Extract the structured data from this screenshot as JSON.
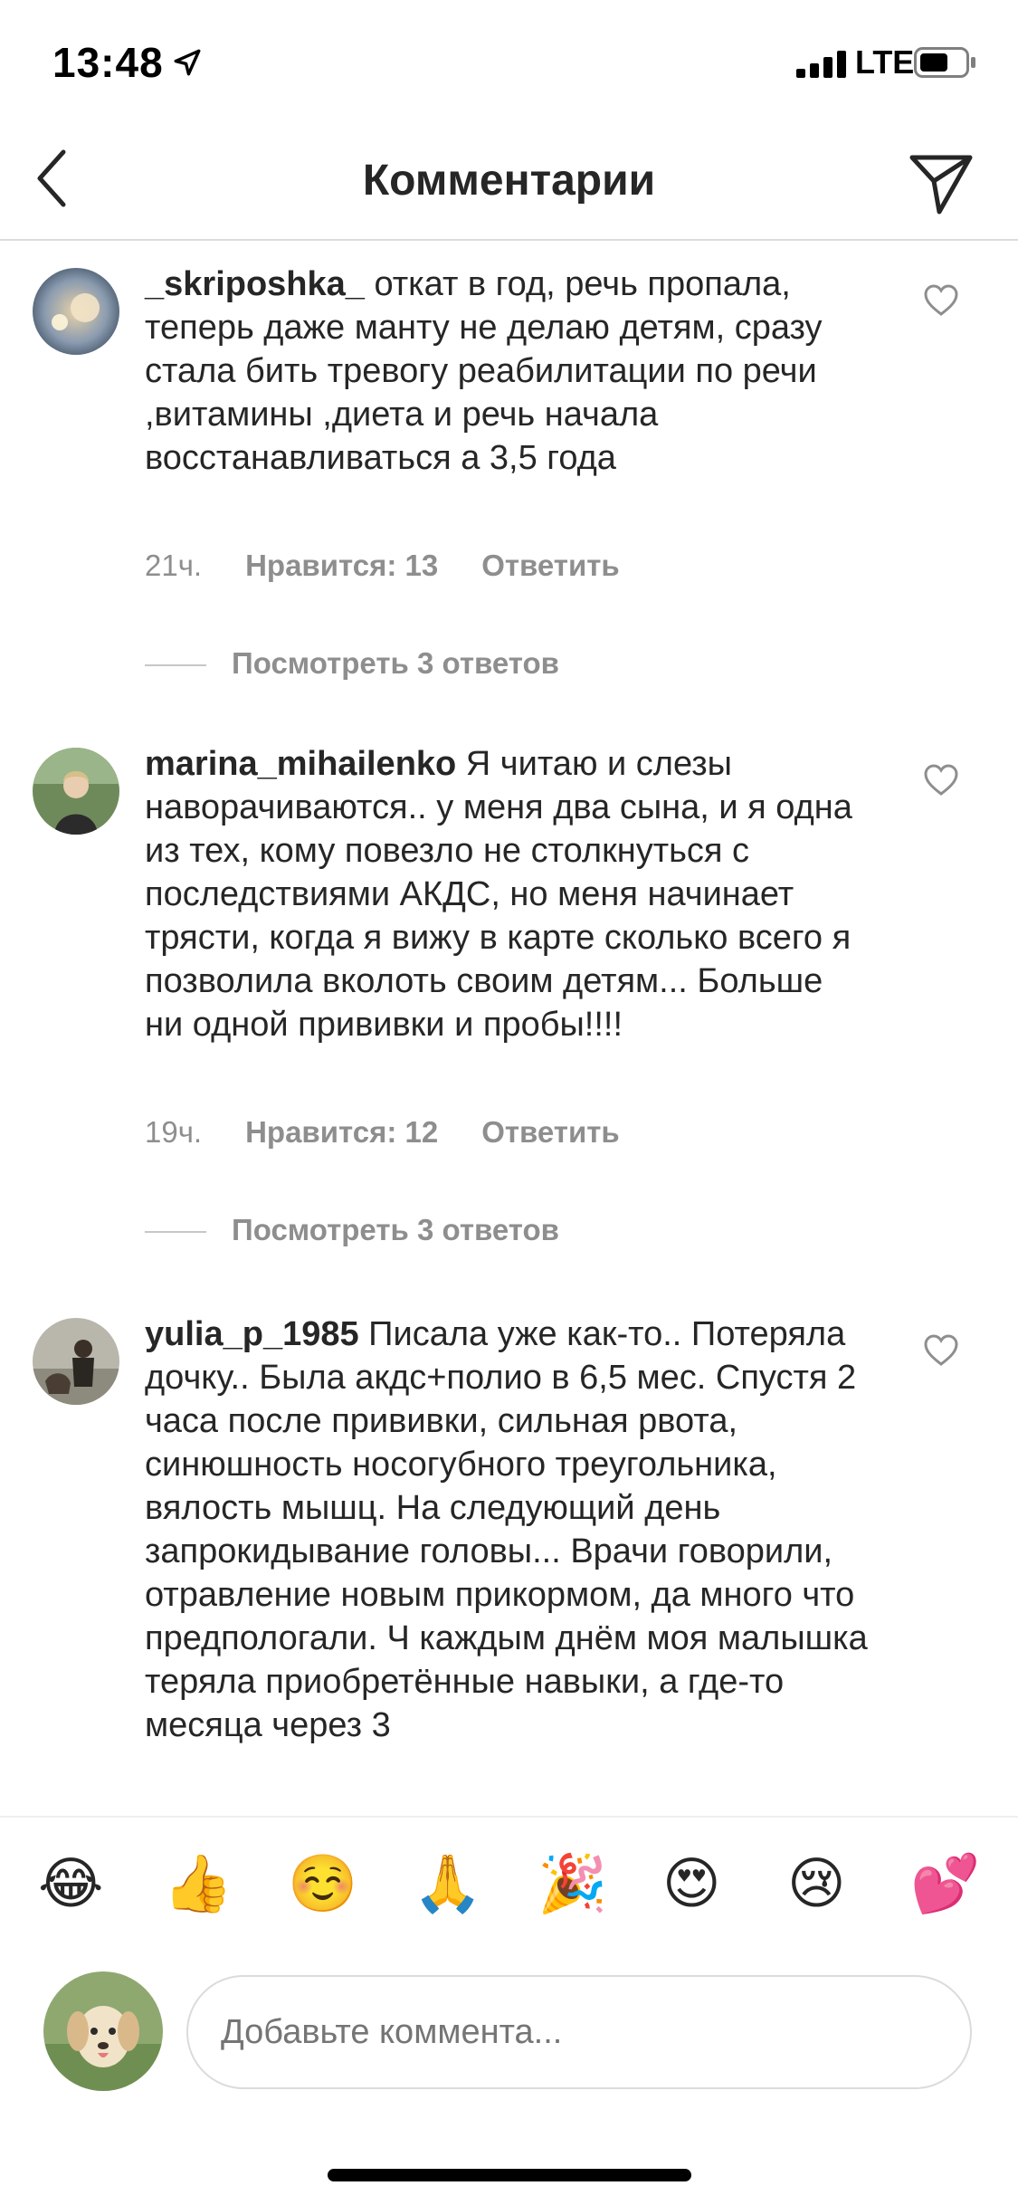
{
  "status_bar": {
    "time": "13:48",
    "network": "LTE"
  },
  "header": {
    "title": "Комментарии"
  },
  "comments": [
    {
      "username": "_skriposhka_",
      "text": " откат в год, речь пропала, теперь даже манту не делаю детям, сразу стала бить тревогу реабилитации по речи ,витамины ,диета и речь начала восстанавливаться а 3,5 года",
      "time": "21ч.",
      "likes": "Нравится: 13",
      "reply": "Ответить",
      "view_replies": "Посмотреть 3 ответов"
    },
    {
      "username": "marina_mihailenko",
      "text": " Я читаю и слезы наворачиваются.. у меня два сына, и я одна из тех, кому повезло не столкнуться с последствиями  АКДС, но меня начинает трясти, когда я вижу в карте сколько всего я позволила вколоть своим детям... Больше ни одной прививки и пробы!!!!",
      "time": "19ч.",
      "likes": "Нравится: 12",
      "reply": "Ответить",
      "view_replies": "Посмотреть 3 ответов"
    },
    {
      "username": "yulia_p_1985",
      "text": " Писала уже как-то.. Потеряла дочку.. Была акдс+полио в 6,5 мес. Спустя 2 часа после прививки, сильная рвота, синюшность носогубного треугольника, вялость мышц. На следующий день запрокидывание головы... Врачи говорили, отравление новым прикормом, да много что предпологали. Ч каждым днём моя малышка  теряла приобретённые навыки, а где-то месяца через 3"
    }
  ],
  "emoji_bar": [
    "😂",
    "👍",
    "☺️",
    "🙏",
    "🎉",
    "😍",
    "😢",
    "💕"
  ],
  "composer": {
    "placeholder": "Добавьте коммента..."
  },
  "colors": {
    "text": "#262626",
    "secondary": "#8e8e8e",
    "divider": "#dbdbdb"
  }
}
